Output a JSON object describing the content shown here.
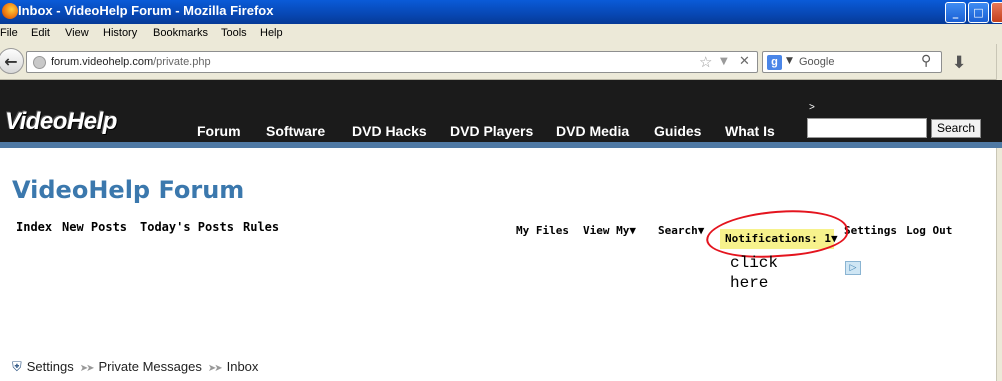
{
  "window": {
    "title": "Inbox - VideoHelp Forum - Mozilla Firefox",
    "controls": {
      "minimize": "_",
      "maximize": "□",
      "close": "✕"
    }
  },
  "menu": {
    "items": [
      "File",
      "Edit",
      "View",
      "History",
      "Bookmarks",
      "Tools",
      "Help"
    ]
  },
  "navbar": {
    "url_domain": "forum.videohelp.com",
    "url_path": "/private.php",
    "search_engine": "Google",
    "search_placeholder": "Google"
  },
  "site": {
    "logo": "VideoHelp",
    "nav": [
      "Forum",
      "Software",
      "DVD Hacks",
      "DVD Players",
      "DVD Media",
      "Guides",
      "What Is"
    ],
    "search_caret": ">",
    "search_button": "Search",
    "header_bg": "#1b1b1b",
    "accent": "#4f79a4"
  },
  "forum": {
    "title": "VideoHelp Forum",
    "title_color": "#3b78ad",
    "links": [
      "Index",
      "New Posts",
      "Today's Posts",
      "Rules"
    ],
    "user_links": {
      "my_files": "My Files",
      "view_my": "View My",
      "search": "Search",
      "notifications": "Notifications: 1",
      "settings": "Settings",
      "logout": "Log Out"
    },
    "annotation": {
      "line1": "click",
      "line2": "here",
      "circle_color": "#e4141e"
    },
    "ad_choice": "▷"
  },
  "breadcrumb": {
    "items": [
      "Settings",
      "Private Messages",
      "Inbox"
    ]
  }
}
